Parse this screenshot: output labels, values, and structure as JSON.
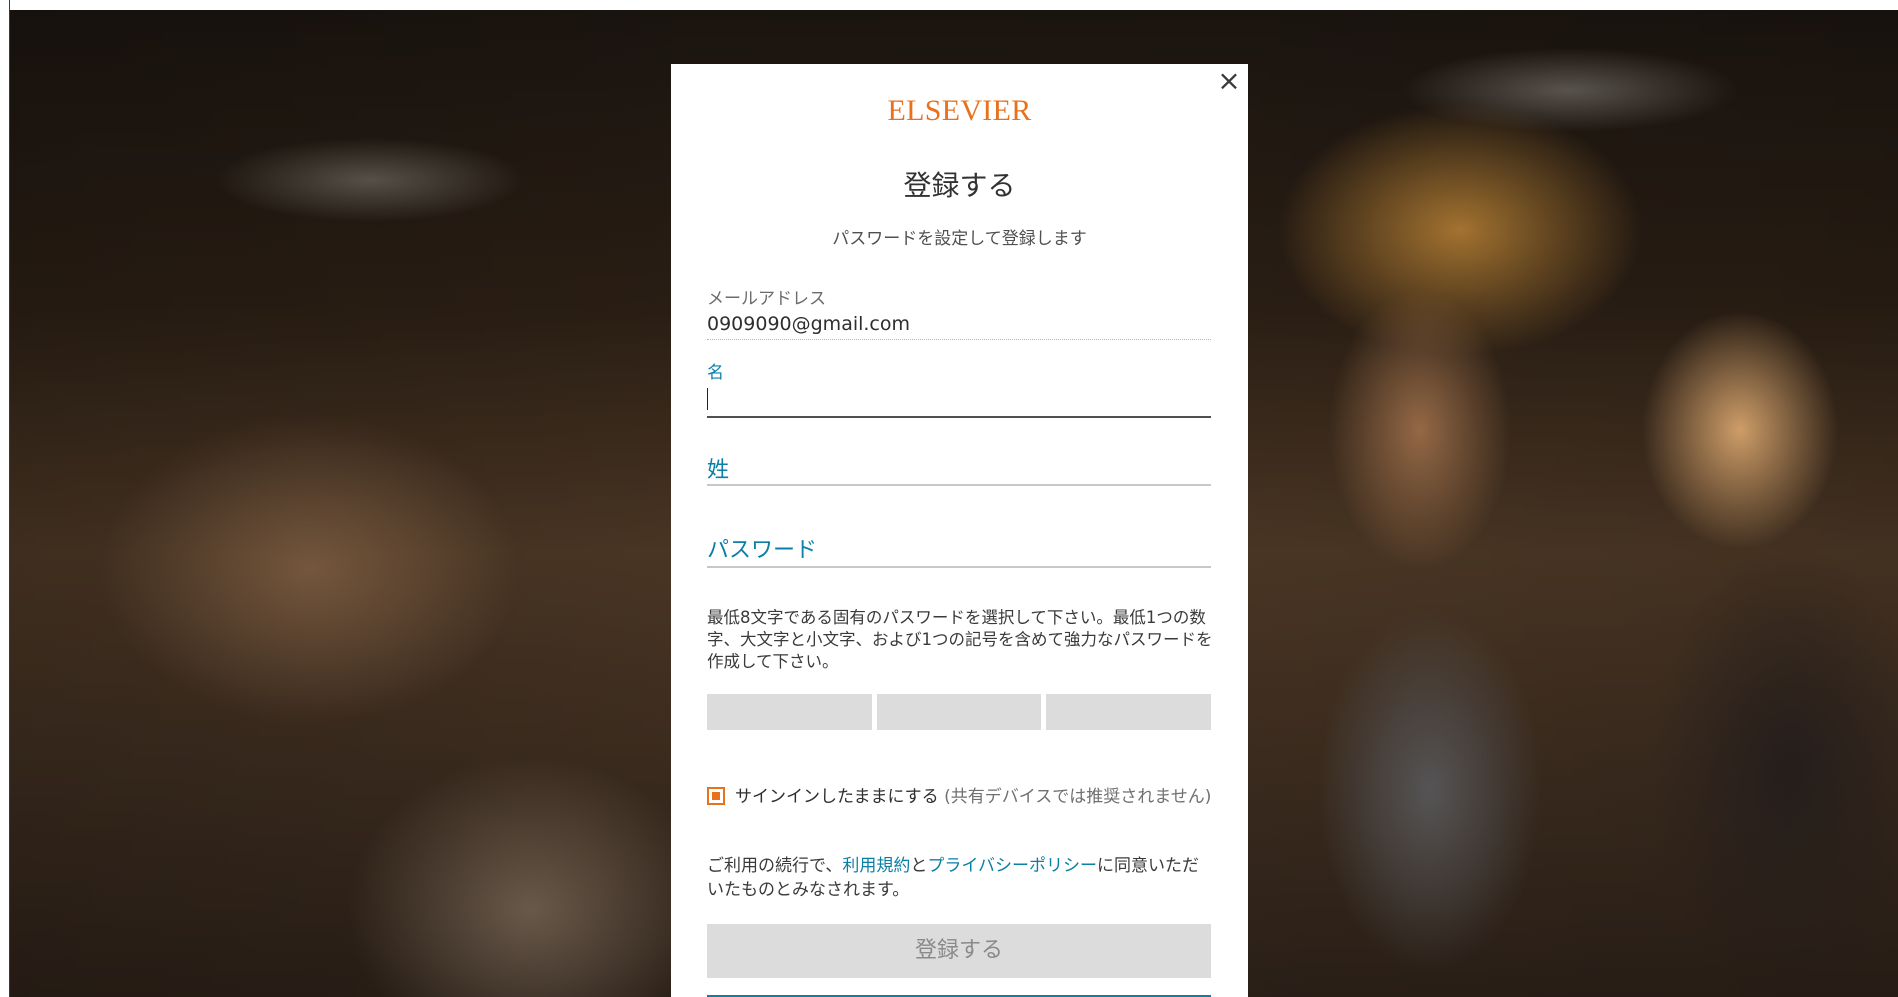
{
  "brand": {
    "logo_text": "ELSEVIER",
    "accent_color": "#e9711c",
    "link_color": "#0c7fa6"
  },
  "dialog": {
    "close_icon": "close-icon",
    "close_glyph": "×",
    "title": "登録する",
    "subtitle": "パスワードを設定して登録します"
  },
  "form": {
    "email": {
      "label": "メールアドレス",
      "value": "0909090@gmail.com"
    },
    "first_name": {
      "label": "名",
      "value": ""
    },
    "last_name": {
      "label": "姓"
    },
    "password": {
      "label": "パスワード"
    },
    "password_help": "最低8文字である固有のパスワードを選択して下さい。最低1つの数字、大文字と小文字、および1つの記号を含めて強力なパスワードを作成して下さい。",
    "strength_segments": 3,
    "remember": {
      "checked": true,
      "label": "サインインしたままにする",
      "note": "(共有デバイスでは推奨されません)"
    },
    "terms": {
      "prefix": "ご利用の続行で、",
      "terms_link": "利用規約",
      "and": "と",
      "privacy_link": "プライバシーポリシー",
      "suffix": "に同意いただいたものとみなされます。"
    },
    "submit_label": "登録する"
  }
}
